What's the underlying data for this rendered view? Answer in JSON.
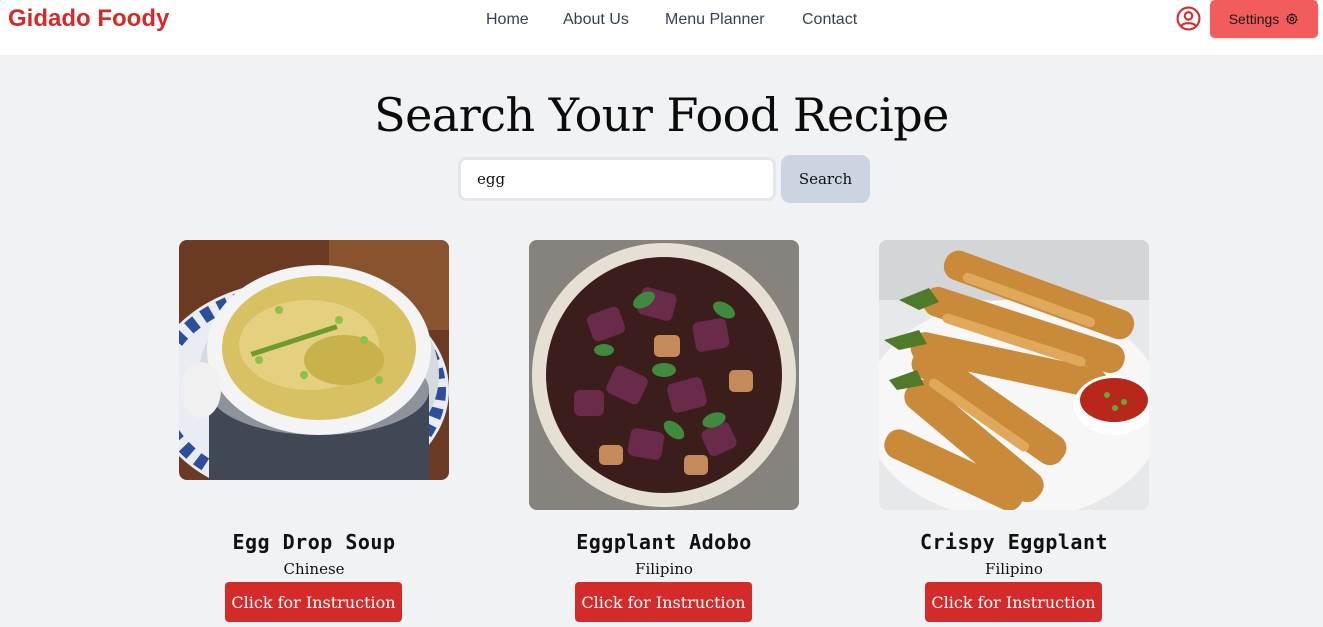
{
  "header": {
    "logo": "Gidado Foody",
    "nav": [
      "Home",
      "About Us",
      "Menu Planner",
      "Contact"
    ],
    "settings_label": "Settings",
    "user_icon": "user-circle-icon",
    "settings_icon": "gear-icon"
  },
  "search": {
    "title": "Search Your Food Recipe",
    "query": "egg",
    "button": "Search"
  },
  "recipes": [
    {
      "name": "Egg Drop Soup",
      "cuisine": "Chinese",
      "button": "Click for Instruction"
    },
    {
      "name": "Eggplant Adobo",
      "cuisine": "Filipino",
      "button": "Click for Instruction"
    },
    {
      "name": "Crispy Eggplant",
      "cuisine": "Filipino",
      "button": "Click for Instruction"
    }
  ],
  "colors": {
    "brand": "#d32a2a",
    "settings": "#f25c5c",
    "search_button": "#cbd5e1",
    "background": "#f1f2f4"
  }
}
